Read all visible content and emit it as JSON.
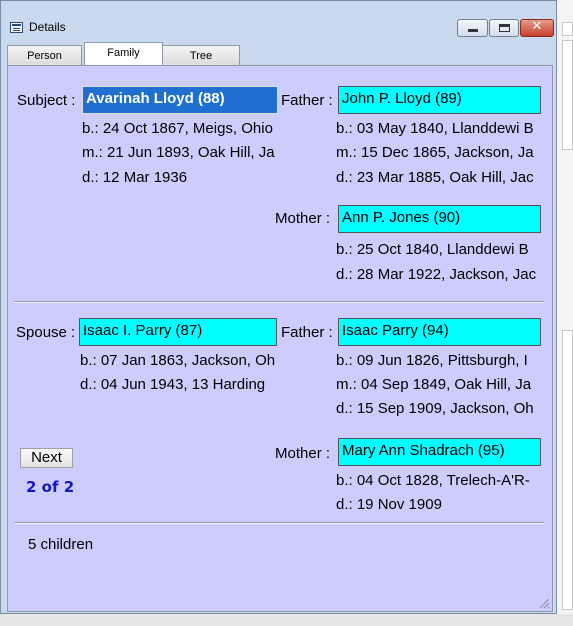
{
  "window": {
    "title": "Details"
  },
  "tabs": [
    {
      "label": "Person"
    },
    {
      "label": "Family"
    },
    {
      "label": "Tree"
    }
  ],
  "subject": {
    "label": "Subject :",
    "name": "Avarinah Lloyd (88)",
    "birth": "b.: 24 Oct 1867, Meigs, Ohio",
    "marriage": "m.: 21 Jun 1893, Oak Hill, Ja",
    "death": "d.: 12 Mar 1936"
  },
  "subject_father": {
    "label": "Father :",
    "name": "John P. Lloyd (89)",
    "birth": "b.: 03 May 1840, Llanddewi B",
    "marriage": "m.: 15 Dec 1865, Jackson, Ja",
    "death": "d.: 23 Mar 1885, Oak Hill, Jac"
  },
  "subject_mother": {
    "label": "Mother :",
    "name": "Ann P. Jones (90)",
    "birth": "b.: 25 Oct 1840, Llanddewi B",
    "death": "d.: 28 Mar 1922, Jackson, Jac"
  },
  "spouse": {
    "label": "Spouse :",
    "name": "Isaac I. Parry (87)",
    "birth": "b.: 07 Jan 1863, Jackson, Oh",
    "death": "d.: 04 Jun 1943, 13 Harding"
  },
  "spouse_father": {
    "label": "Father :",
    "name": "Isaac Parry (94)",
    "birth": "b.: 09 Jun 1826, Pittsburgh, I",
    "marriage": "m.: 04 Sep 1849, Oak Hill, Ja",
    "death": "d.: 15 Sep 1909, Jackson, Oh"
  },
  "spouse_mother": {
    "label": "Mother :",
    "name": "Mary Ann Shadrach (95)",
    "birth": "b.: 04 Oct 1828, Trelech-A'R-",
    "death": "d.: 19 Nov 1909"
  },
  "nav": {
    "next_label": "Next",
    "counter": "2 of  2"
  },
  "children": {
    "text": "5 children"
  },
  "colors": {
    "panel": "#ccccfd",
    "name_box": "#00ffff",
    "selected": "#1f6fd0",
    "counter": "#1515c8"
  },
  "icons": {
    "app": "details-icon",
    "minimize": "minimize-icon",
    "maximize": "maximize-icon",
    "close": "close-icon"
  },
  "close_glyph": "✕"
}
